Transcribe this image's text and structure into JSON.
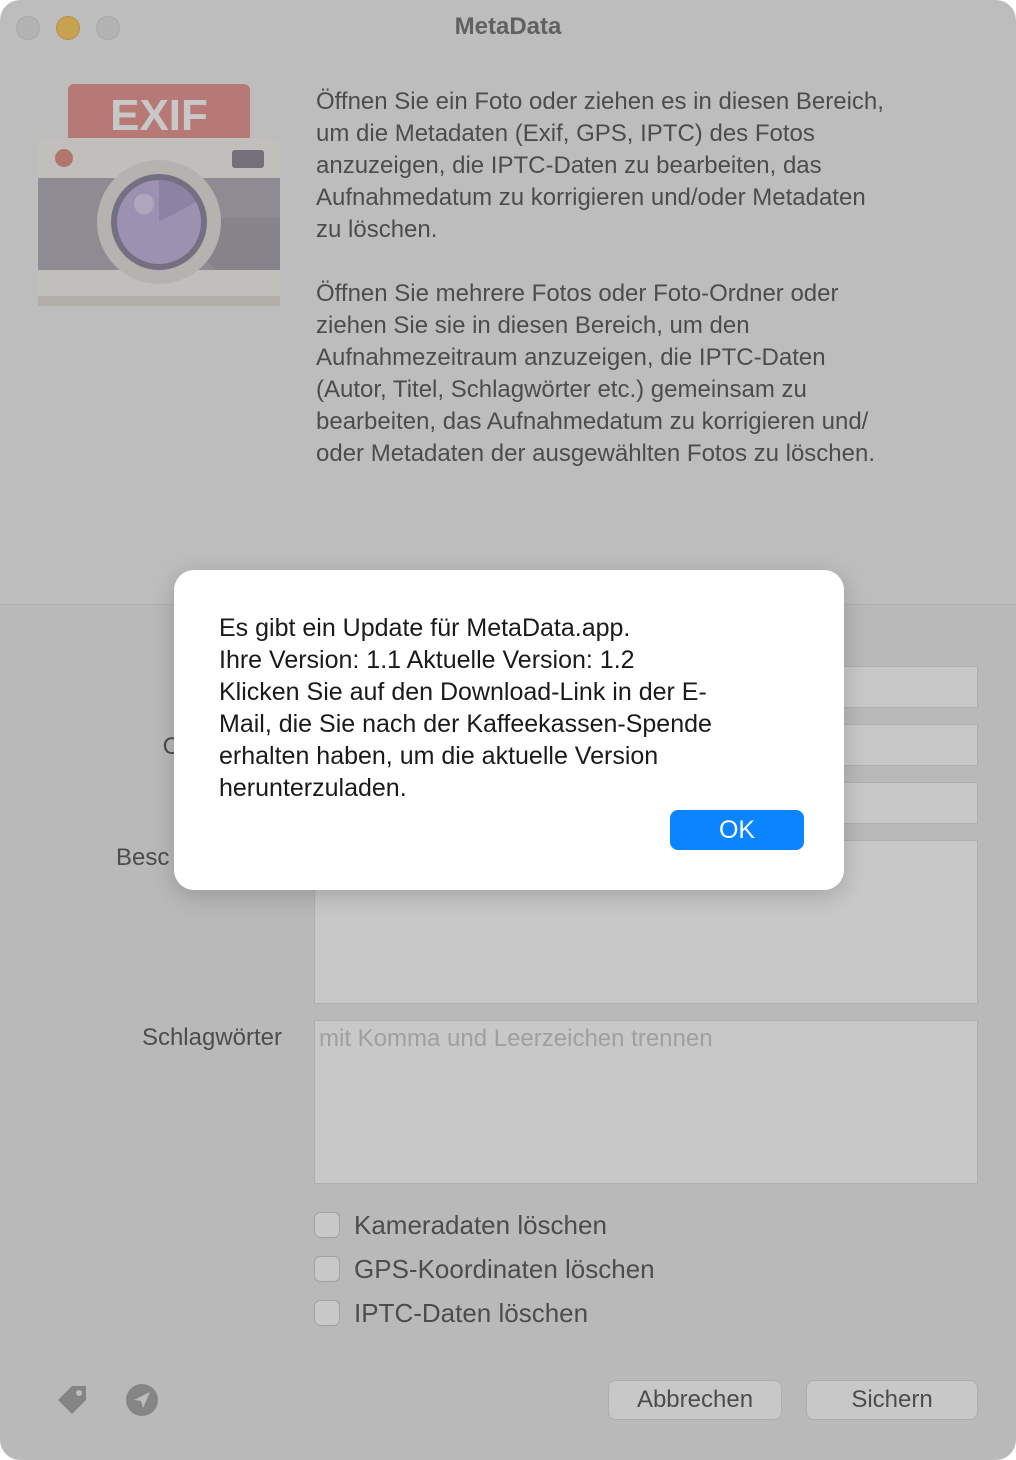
{
  "window": {
    "title": "MetaData"
  },
  "intro": {
    "paragraph1": [
      "Öffnen Sie ein Foto oder ziehen es in diesen Bereich,",
      "um die Metadaten (Exif, GPS, IPTC) des Fotos",
      "anzuzeigen, die IPTC-Daten zu bearbeiten, das",
      "Aufnahmedatum zu korrigieren und/oder Metadaten",
      "zu löschen."
    ],
    "paragraph2": [
      "Öffnen Sie mehrere Fotos oder Foto-Ordner oder",
      "ziehen Sie sie in diesen Bereich, um den",
      "Aufnahmezeitraum anzuzeigen, die IPTC-Daten",
      "(Autor, Titel, Schlagwörter etc.) gemeinsam zu",
      "bearbeiten, das Aufnahmedatum zu korrigieren und/",
      "oder Metadaten der ausgewählten Fotos zu löschen."
    ]
  },
  "logo": {
    "badge_text": "EXIF"
  },
  "form": {
    "label_partial_1": "C",
    "label_partial_2": "Besc",
    "keywords_label": "Schlagwörter",
    "keywords_placeholder": "mit Komma und Leerzeichen trennen"
  },
  "options": [
    {
      "label": "Kameradaten löschen",
      "checked": false
    },
    {
      "label": "GPS-Koordinaten löschen",
      "checked": false
    },
    {
      "label": "IPTC-Daten löschen",
      "checked": false
    }
  ],
  "footer": {
    "cancel_label": "Abbrechen",
    "save_label": "Sichern",
    "tag_icon": "tag-icon",
    "location_icon": "location-arrow-icon"
  },
  "dialog": {
    "lines": [
      "Es gibt ein Update für MetaData.app.",
      "Ihre Version: 1.1  Aktuelle Version: 1.2",
      "Klicken Sie auf den Download-Link in der E-",
      "Mail, die Sie nach der Kaffeekassen-Spende",
      "erhalten haben, um die aktuelle Version",
      "herunterzuladen."
    ],
    "ok_label": "OK"
  },
  "colors": {
    "accent": "#0a84ff",
    "minimize": "#febc2e",
    "exif_badge": "#e0756f"
  }
}
